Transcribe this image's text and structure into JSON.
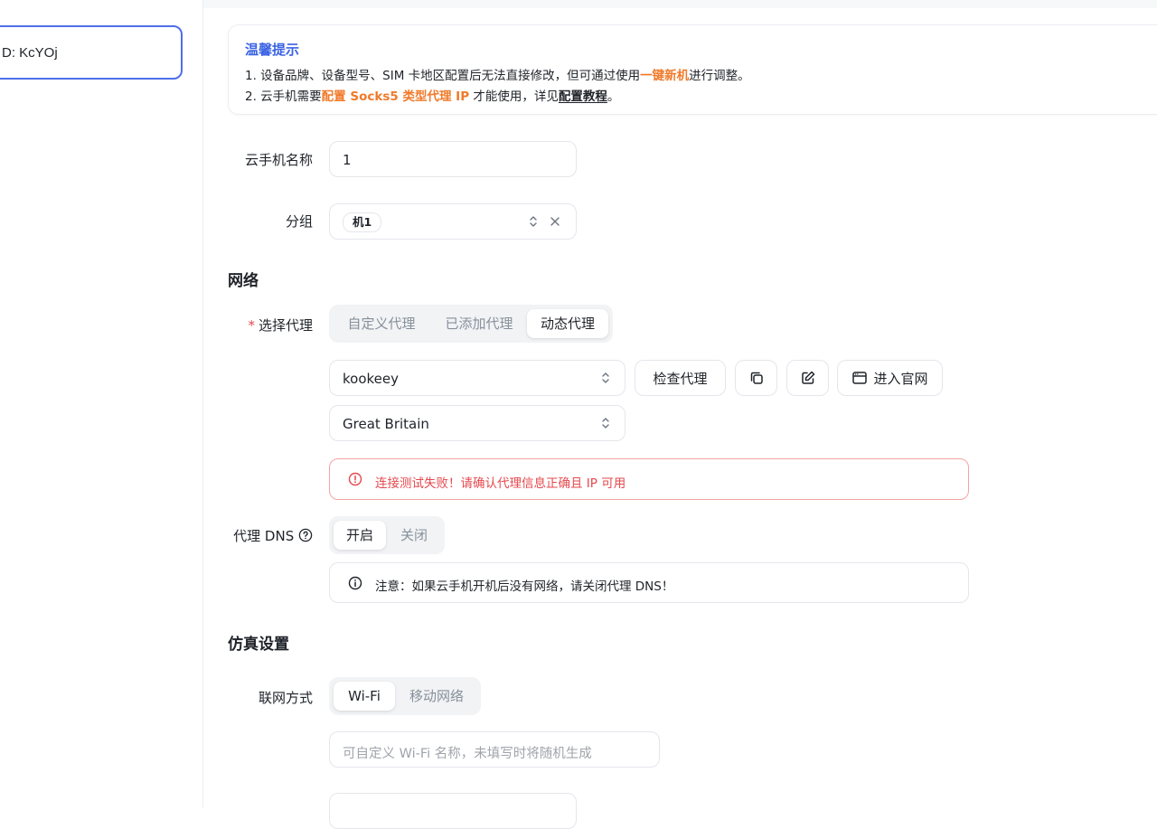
{
  "device": {
    "id_label": "D: KcYOj"
  },
  "tip": {
    "title": "温馨提示",
    "line1_prefix": "1. 设备品牌、设备型号、SIM 卡地区配置后无法直接修改，但可通过使用",
    "line1_link": "一键新机",
    "line1_suffix": "进行调整。",
    "line2_prefix": "2. 云手机需要",
    "line2_highlight": "配置 Socks5 类型代理 IP",
    "line2_middle": " 才能使用，详见",
    "line2_link": "配置教程",
    "line2_suffix": "。"
  },
  "form": {
    "name_label": "云手机名称",
    "name_value": "1",
    "group_label": "分组",
    "group_tag": "机1"
  },
  "network": {
    "section_title": "网络",
    "proxy_label": "选择代理",
    "proxy_tabs": [
      "自定义代理",
      "已添加代理",
      "动态代理"
    ],
    "proxy_active": "动态代理",
    "provider_value": "kookeey",
    "region_value": "Great Britain",
    "check_button": "检查代理",
    "official_button": "进入官网",
    "error_msg": "连接测试失败！请确认代理信息正确且 IP 可用",
    "dns_label": "代理 DNS",
    "dns_options": [
      "开启",
      "关闭"
    ],
    "dns_active": "开启",
    "dns_note": "注意：如果云手机开机后没有网络，请关闭代理 DNS！"
  },
  "simulation": {
    "section_title": "仿真设置",
    "conn_label": "联网方式",
    "conn_options": [
      "Wi-Fi",
      "移动网络"
    ],
    "conn_active": "Wi-Fi",
    "wifi_placeholder": "可自定义 Wi-Fi 名称，未填写时将随机生成"
  },
  "colors": {
    "accent": "#3b63e3",
    "highlight": "#f07a2a",
    "error": "#e5484d"
  }
}
